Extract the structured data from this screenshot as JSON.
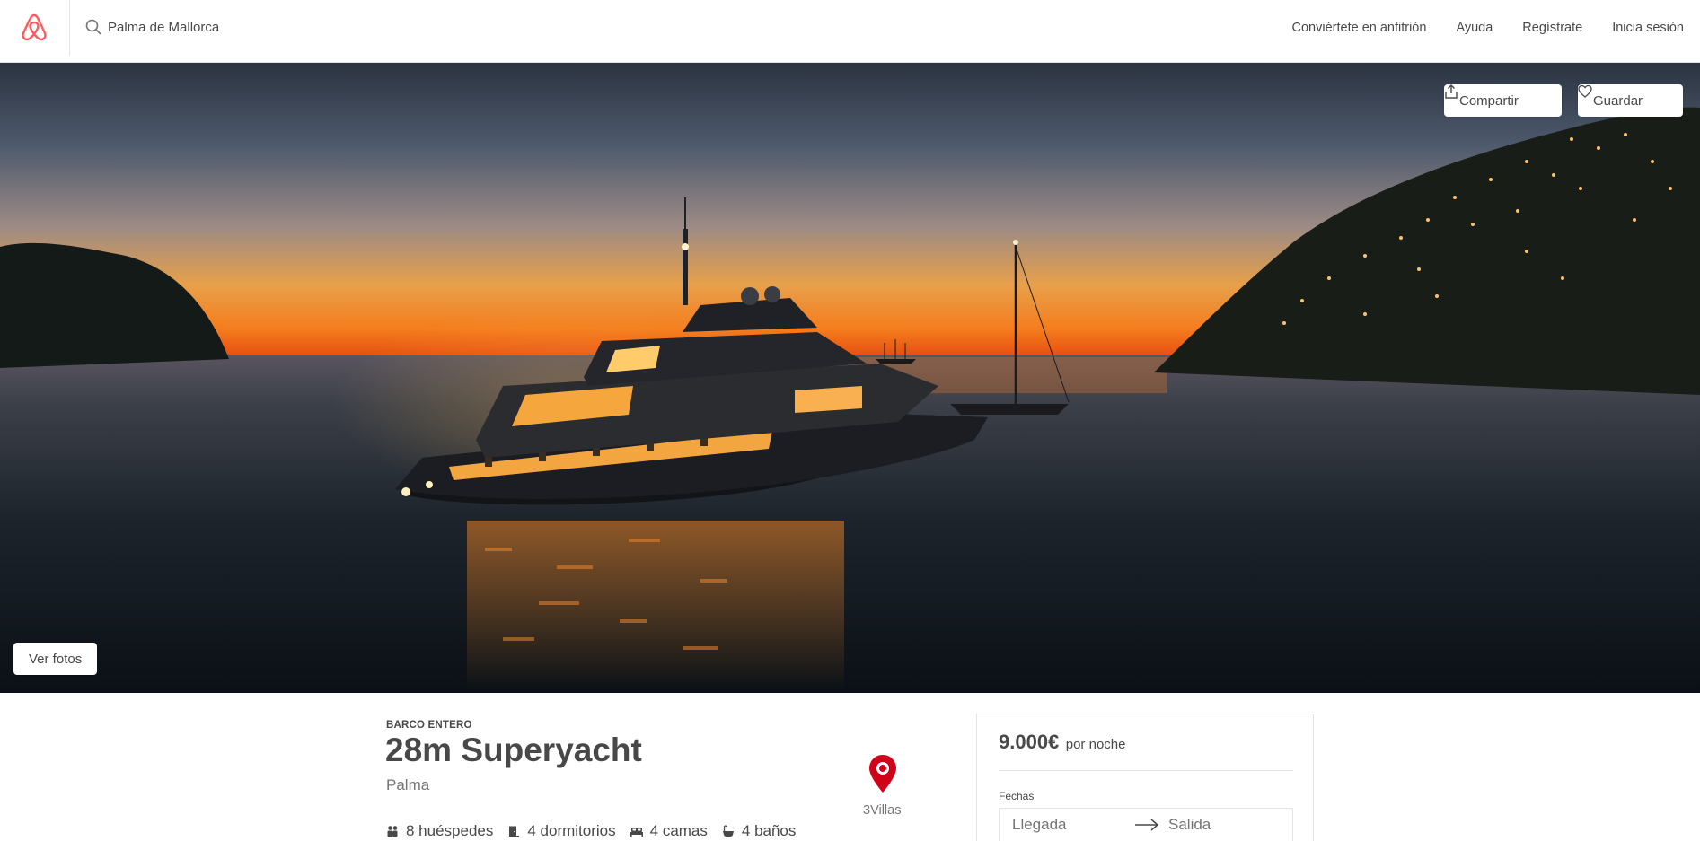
{
  "header": {
    "search": {
      "value": "Palma de Mallorca"
    },
    "nav": [
      {
        "label": "Conviértete en anfitrión"
      },
      {
        "label": "Ayuda"
      },
      {
        "label": "Regístrate"
      },
      {
        "label": "Inicia sesión"
      }
    ]
  },
  "hero": {
    "share_label": "Compartir",
    "save_label": "Guardar",
    "photos_label": "Ver fotos"
  },
  "listing": {
    "kind": "BARCO ENTERO",
    "title": "28m Superyacht",
    "city": "Palma",
    "host": "3Villas",
    "amenities": [
      {
        "icon": "guests-icon",
        "label": "8 huéspedes"
      },
      {
        "icon": "bedroom-icon",
        "label": "4 dormitorios"
      },
      {
        "icon": "bed-icon",
        "label": "4 camas"
      },
      {
        "icon": "bath-icon",
        "label": "4 baños"
      }
    ]
  },
  "booking": {
    "price": "9.000€",
    "price_unit": "por noche",
    "dates_label": "Fechas",
    "checkin_placeholder": "Llegada",
    "checkout_placeholder": "Salida"
  },
  "colors": {
    "brand": "#ff5a5f",
    "text": "#484848",
    "muted": "#767676",
    "pin": "#d0021b"
  }
}
